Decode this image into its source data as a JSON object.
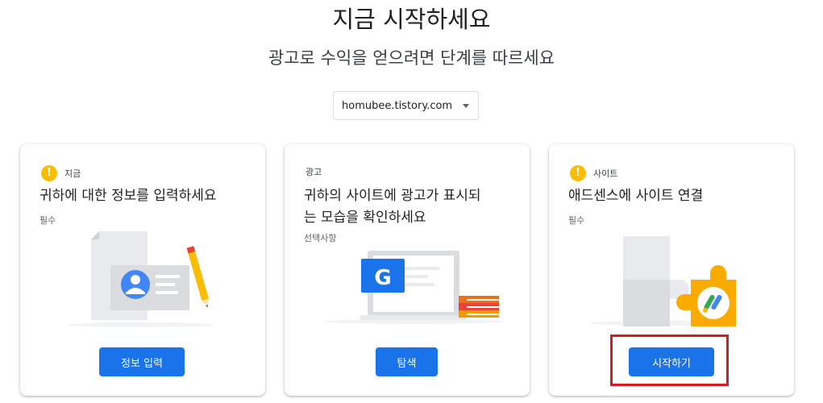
{
  "header": {
    "title": "지금 시작하세요",
    "subtitle": "광고로 수익을 얻으려면 단계를 따르세요"
  },
  "site_select": {
    "value": "homubee.tistory.com"
  },
  "colors": {
    "primary": "#1a73e8",
    "warning": "#fbbc04",
    "highlight": "#d71921"
  },
  "cards": [
    {
      "status_icon": "warning-icon",
      "status_label": "지금",
      "heading": "귀하에 대한 정보를 입력하세요",
      "requirement": "필수",
      "button_label": "정보 입력"
    },
    {
      "status_label": "광고",
      "heading_line1": "귀하의 사이트에 광고가 표시되",
      "heading_line2": "는 모습을 확인하세요",
      "requirement": "선택사항",
      "button_label": "탐색",
      "illustration_letter": "G"
    },
    {
      "status_icon": "warning-icon",
      "status_label": "사이트",
      "heading": "애드센스에 사이트 연결",
      "requirement": "필수",
      "button_label": "시작하기"
    }
  ]
}
